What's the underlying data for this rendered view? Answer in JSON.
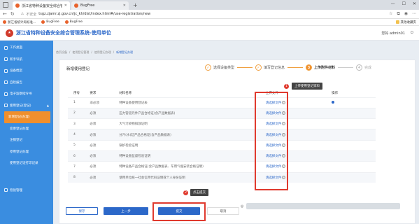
{
  "browser": {
    "tabs": [
      {
        "title": "浙江省特种设备安全综合管理系统",
        "active": true
      },
      {
        "title": "BugFree",
        "active": false
      }
    ],
    "new_tab": "+",
    "not_secure": "不安全",
    "url": "tsgz.zjamr.zj.gov.cn/jc_kh/dist/index.html#/use-registration/new",
    "bookmarks": [
      "浙江省统计局标准...",
      "BugFree",
      "BugFree",
      "其他收藏夹"
    ]
  },
  "header": {
    "title": "浙江省特种设备安全综合管理系统-使用单位",
    "user_label": "您好 admin01"
  },
  "sidebar": {
    "items": [
      {
        "label": "工作桌面",
        "active": false,
        "sub": false
      },
      {
        "label": "新手导航",
        "active": false,
        "sub": false
      },
      {
        "label": "设备档案",
        "active": false,
        "sub": false
      },
      {
        "label": "自检报告",
        "active": false,
        "sub": false
      },
      {
        "label": "电子监察指令书",
        "active": false,
        "sub": false
      },
      {
        "label": "使用登记(登记)",
        "active": false,
        "sub": false,
        "has_chevron": true
      },
      {
        "label": "新增登记(办理)",
        "active": true,
        "sub": true
      },
      {
        "label": "变更登记办理",
        "active": false,
        "sub": true
      },
      {
        "label": "注销登记",
        "active": false,
        "sub": true
      },
      {
        "label": "停用登记办理",
        "active": false,
        "sub": true
      },
      {
        "label": "使用登记证打印记录",
        "active": false,
        "sub": true
      },
      {
        "label": "检验管理",
        "active": false,
        "sub": false
      }
    ]
  },
  "breadcrumbs": [
    "首页设备",
    "使用登记管理",
    "使用登记办理",
    "新增登记办理"
  ],
  "card": {
    "title": "新增使用登记"
  },
  "steps": [
    {
      "num": "✓",
      "label": "选择设备类型",
      "state": "done"
    },
    {
      "num": "✓",
      "label": "填写登记信息",
      "state": "done"
    },
    {
      "num": "3",
      "label": "上传附件材料",
      "state": "active"
    },
    {
      "num": "4",
      "label": "完成",
      "state": "todo"
    }
  ],
  "table": {
    "headers": [
      "序号",
      "要求",
      "材料名称",
      "上传文件",
      "操作"
    ],
    "rows": [
      {
        "no": "1",
        "req": "非必须",
        "name": "特种设备使用登记表",
        "upload": "请选择文件",
        "op": "dot"
      },
      {
        "no": "2",
        "req": "必须",
        "name": "压力管道元件产品合格证(含产品数据表)",
        "upload": "请选择文件",
        "op": ""
      },
      {
        "no": "3",
        "req": "必须",
        "name": "大气污染物排放证明",
        "upload": "请选择文件",
        "op": ""
      },
      {
        "no": "4",
        "req": "必须",
        "name": "分汽(水)缸产品合格证(含产品数据表)",
        "upload": "请选择文件",
        "op": ""
      },
      {
        "no": "5",
        "req": "必须",
        "name": "锅炉检验证明",
        "upload": "请选择文件",
        "op": ""
      },
      {
        "no": "6",
        "req": "必须",
        "name": "特种设备监督检验证明",
        "upload": "请选择文件",
        "op": ""
      },
      {
        "no": "7",
        "req": "必须",
        "name": "特种设备产品合格证(含产品数据表、车用气瓶安装合格证明)",
        "upload": "请选择文件",
        "op": ""
      },
      {
        "no": "8",
        "req": "必须",
        "name": "使用单位统一社会信用代码证明或个人身份证明",
        "upload": "请选择文件",
        "op": ""
      }
    ]
  },
  "annotations": {
    "upload_tip": "上传使用登记资料",
    "submit_tip": "点击提交",
    "badge1": "1",
    "badge2": "2"
  },
  "buttons": {
    "save": "保存",
    "prev": "上一步",
    "submit": "提交",
    "cancel": "取消"
  },
  "colors": {
    "primary": "#2c68c9",
    "sidebar": "#3a8de0",
    "active": "#f08f2d",
    "annotation": "#e03a2e"
  }
}
